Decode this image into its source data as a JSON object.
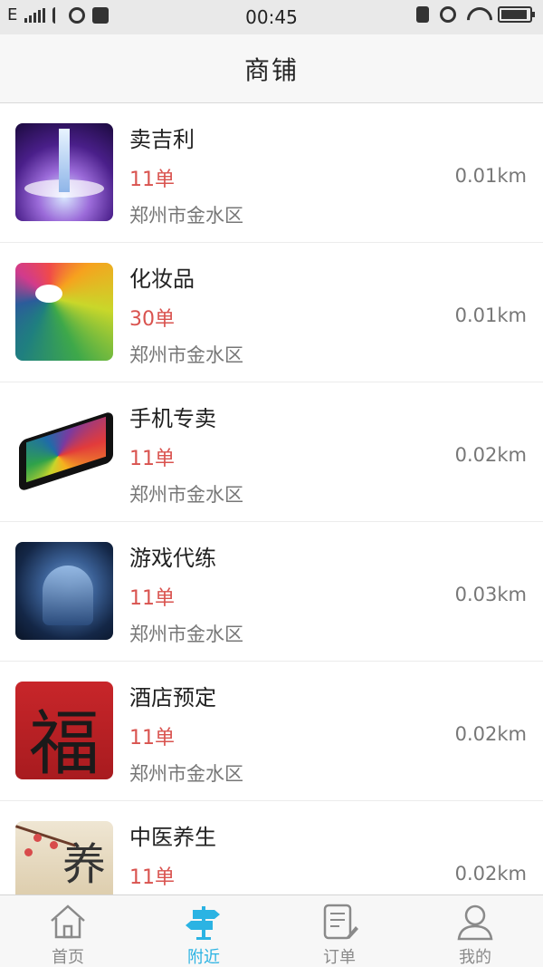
{
  "status_bar": {
    "carrier": "E",
    "time": "00:45"
  },
  "header": {
    "title": "商铺"
  },
  "shops": [
    {
      "name": "卖吉利",
      "orders": "11单",
      "distance": "0.01km",
      "address": "郑州市金水区",
      "image": "tower-lights"
    },
    {
      "name": "化妆品",
      "orders": "30单",
      "distance": "0.01km",
      "address": "郑州市金水区",
      "image": "color-petals"
    },
    {
      "name": "手机专卖",
      "orders": "11单",
      "distance": "0.02km",
      "address": "郑州市金水区",
      "image": "smartphone"
    },
    {
      "name": "游戏代练",
      "orders": "11单",
      "distance": "0.03km",
      "address": "郑州市金水区",
      "image": "game-character"
    },
    {
      "name": "酒店预定",
      "orders": "11单",
      "distance": "0.02km",
      "address": "郑州市金水区",
      "image": "fu-calligraphy"
    },
    {
      "name": "中医养生",
      "orders": "11单",
      "distance": "0.02km",
      "address": "",
      "image": "plum-blossom-painting"
    }
  ],
  "tabs": [
    {
      "label": "首页",
      "icon": "home-icon",
      "active": false
    },
    {
      "label": "附近",
      "icon": "signpost-icon",
      "active": true
    },
    {
      "label": "订单",
      "icon": "order-note-icon",
      "active": false
    },
    {
      "label": "我的",
      "icon": "person-icon",
      "active": false
    }
  ],
  "colors": {
    "accent": "#2bb3e3",
    "orders_red": "#d9534f"
  }
}
